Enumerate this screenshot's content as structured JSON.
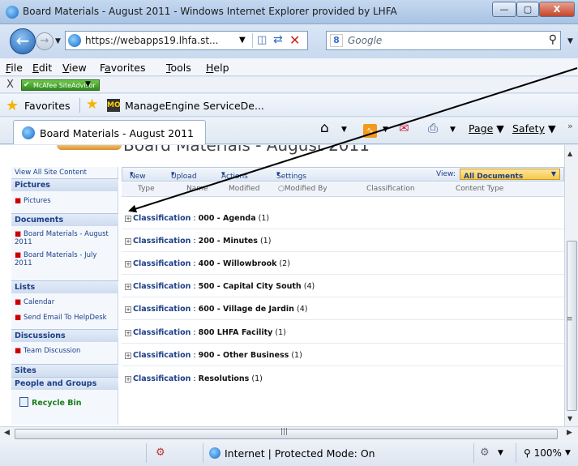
{
  "window": {
    "title": "Board Materials - August 2011 - Windows Internet Explorer provided by LHFA",
    "minimize": "—",
    "maximize": "▢",
    "close": "X"
  },
  "nav": {
    "url": "https://webapps19.lhfa.st...",
    "search_placeholder": "Google"
  },
  "menu": [
    "File",
    "Edit",
    "View",
    "Favorites",
    "Tools",
    "Help"
  ],
  "mcafee": {
    "close": "X",
    "label": "McAfee SiteAdvisor"
  },
  "favorites": {
    "label": "Favorites",
    "items": [
      "ManageEngine ServiceDe..."
    ]
  },
  "tab": {
    "label": "Board Materials - August 2011"
  },
  "commands": {
    "page": "Page",
    "safety": "Safety"
  },
  "page": {
    "title": "Board Materials - August 2011"
  },
  "quicklaunch": {
    "view_all": "View All Site Content",
    "sections": [
      {
        "heading": "Pictures",
        "items": [
          "Pictures"
        ]
      },
      {
        "heading": "Documents",
        "items": [
          "Board Materials - August 2011",
          "Board Materials - July 2011"
        ]
      },
      {
        "heading": "Lists",
        "items": [
          "Calendar",
          "Send Email To HelpDesk"
        ]
      },
      {
        "heading": "Discussions",
        "items": [
          "Team Discussion"
        ]
      },
      {
        "heading": "Sites",
        "items": []
      },
      {
        "heading": "People and Groups",
        "items": []
      }
    ],
    "recycle_bin": "Recycle Bin"
  },
  "toolbar": {
    "new": "New",
    "upload": "Upload",
    "actions": "Actions",
    "settings": "Settings",
    "view_label": "View:",
    "view_value": "All Documents"
  },
  "columns": [
    "Type",
    "Name",
    "Modified",
    "Modified By",
    "Classification",
    "Content Type"
  ],
  "groups": [
    {
      "label": "Classification",
      "value": "000 - Agenda",
      "count": "(1)"
    },
    {
      "label": "Classification",
      "value": "200 - Minutes",
      "count": "(1)"
    },
    {
      "label": "Classification",
      "value": "400 - Willowbrook",
      "count": "(2)"
    },
    {
      "label": "Classification",
      "value": "500 - Capital City South",
      "count": "(4)"
    },
    {
      "label": "Classification",
      "value": "600 - Village de Jardin",
      "count": "(4)"
    },
    {
      "label": "Classification",
      "value": "800 LHFA Facility",
      "count": "(1)"
    },
    {
      "label": "Classification",
      "value": "900 - Other Business",
      "count": "(1)"
    },
    {
      "label": "Classification",
      "value": "Resolutions",
      "count": "(1)"
    }
  ],
  "status": {
    "zone": "Internet | Protected Mode: On",
    "zoom": "100%"
  },
  "colors": {
    "link": "#1d3f88",
    "accent_view": "#f6c84a",
    "recycle": "#1a7d1a"
  }
}
